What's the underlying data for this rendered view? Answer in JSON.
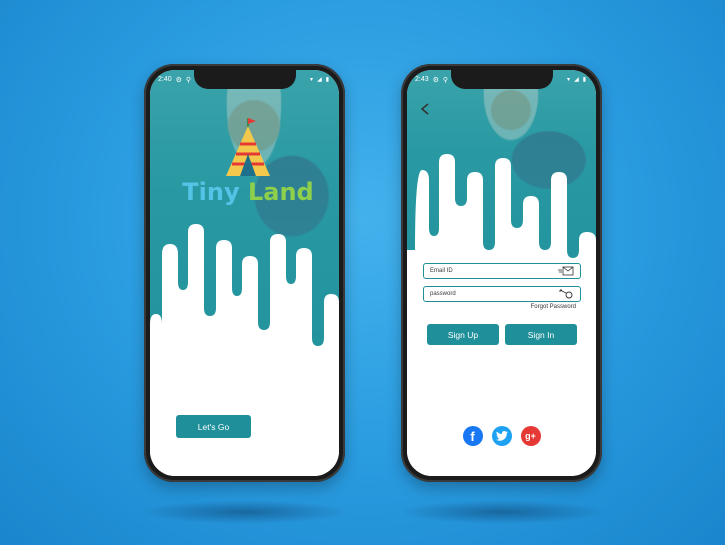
{
  "colors": {
    "background": "#2a9ce0",
    "teal": "#1f8f99",
    "facebook": "#1877f2",
    "twitter": "#1da1f2",
    "google_plus": "#e53935"
  },
  "splash_screen": {
    "status_time": "2:40",
    "logo": {
      "text_1": "Tiny",
      "text_2": "Land"
    },
    "lets_go_label": "Let's Go"
  },
  "login_screen": {
    "status_time": "2:43",
    "email_placeholder": "Email ID",
    "password_placeholder": "password",
    "forgot_password": "Forgot Password",
    "sign_up_label": "Sign Up",
    "sign_in_label": "Sign In",
    "social": {
      "facebook_glyph": "f",
      "google_plus_glyph": "g+"
    }
  }
}
